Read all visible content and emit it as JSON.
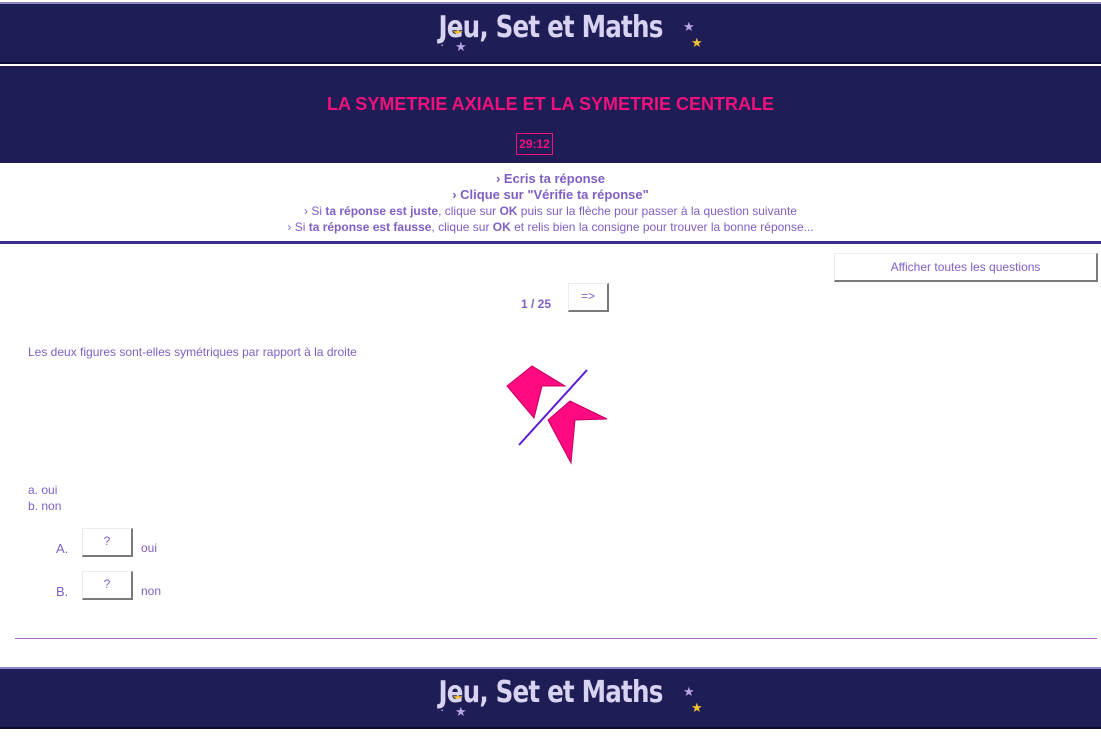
{
  "banner": {
    "logo_text": "Jeu, Set et Maths"
  },
  "header": {
    "title": "LA SYMETRIE AXIALE ET LA SYMETRIE CENTRALE",
    "timer": "29:12"
  },
  "instructions": {
    "line1": "› Ecris ta réponse",
    "line2": "› Clique sur \"Vérifie ta réponse\"",
    "line3_pre": "› Si ",
    "line3_bold1": "ta réponse est juste",
    "line3_mid": ", clique sur ",
    "line3_bold2": "OK",
    "line3_post": " puis sur la flèche pour passer à la question suivante",
    "line4_pre": "› Si ",
    "line4_bold1": "ta réponse est fausse",
    "line4_mid": ", clique sur ",
    "line4_bold2": "OK",
    "line4_post": " et relis bien la consigne pour trouver la bonne réponse..."
  },
  "controls": {
    "show_all_label": "Afficher toutes les questions",
    "next_label": "=>"
  },
  "pager": {
    "text": "1 / 25"
  },
  "question": {
    "text": "Les deux figures sont-elles symétriques par rapport à la droite",
    "options": [
      "a. oui",
      "b. non"
    ]
  },
  "answers": [
    {
      "letter": "A.",
      "button": "?",
      "text": "oui"
    },
    {
      "letter": "B.",
      "button": "?",
      "text": "non"
    }
  ],
  "colors": {
    "banner_bg": "#1e1d55",
    "title_pink": "#f0117c",
    "text_purple": "#7f5fc4",
    "shape_pink": "#ff0a80",
    "axis_purple": "#5b1bd6"
  }
}
